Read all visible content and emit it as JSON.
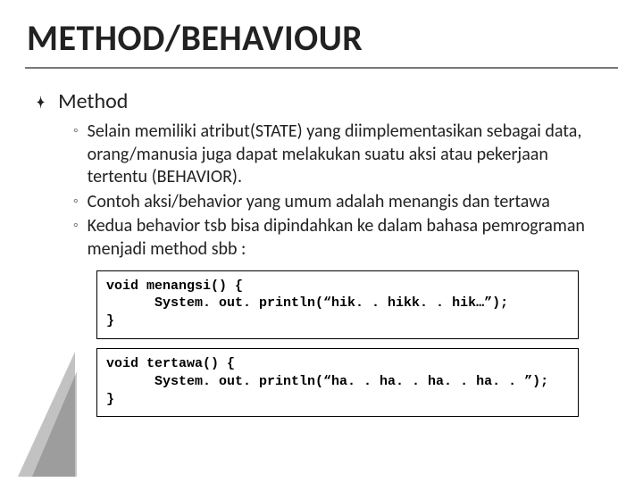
{
  "title": "METHOD/BEHAVIOUR",
  "l1_heading": "Method",
  "bullets": [
    "Selain memiliki atribut(STATE) yang diimplementasikan sebagai data, orang/manusia juga dapat melakukan suatu aksi atau pekerjaan tertentu (BEHAVIOR).",
    "Contoh aksi/behavior yang umum adalah menangis dan tertawa",
    "Kedua behavior tsb bisa dipindahkan ke dalam bahasa pemrograman menjadi method sbb :"
  ],
  "code1": "void menangsi() {\n      System. out. println(“hik. . hikk. . hik…”);\n}",
  "code2": "void tertawa() {\n      System. out. println(“ha. . ha. . ha. . ha. . ”);\n}"
}
